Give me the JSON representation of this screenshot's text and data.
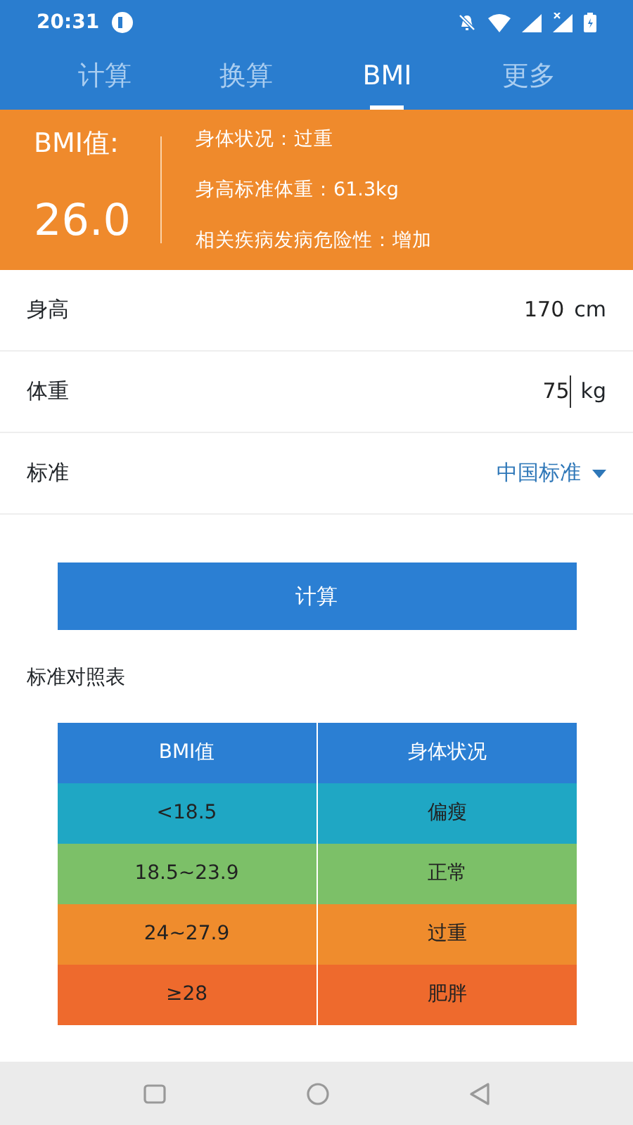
{
  "status_bar": {
    "time": "20:31"
  },
  "tabs": [
    {
      "label": "计算",
      "selected": false
    },
    {
      "label": "换算",
      "selected": false
    },
    {
      "label": "BMI",
      "selected": true
    },
    {
      "label": "更多",
      "selected": false
    }
  ],
  "result": {
    "label": "BMI值:",
    "value": "26.0",
    "details": [
      "身体状况：过重",
      "身高标准体重：61.3kg",
      "相关疾病发病危险性：增加"
    ]
  },
  "fields": [
    {
      "label": "身高",
      "value": "170",
      "unit": "cm",
      "kind": "input",
      "focused": false
    },
    {
      "label": "体重",
      "value": "75",
      "unit": "kg",
      "kind": "input",
      "focused": true
    },
    {
      "label": "标准",
      "value": "中国标准",
      "kind": "dropdown"
    }
  ],
  "button": "计算",
  "table_title": "标准对照表",
  "table": {
    "columns": [
      "BMI值",
      "身体状况"
    ],
    "rows": [
      {
        "cells": [
          "<18.5",
          "偏瘦"
        ],
        "color": "#1fa7c4"
      },
      {
        "cells": [
          "18.5~23.9",
          "正常"
        ],
        "color": "#7cc068"
      },
      {
        "cells": [
          "24~27.9",
          "过重"
        ],
        "color": "#ef8c2d"
      },
      {
        "cells": [
          "≥28",
          "肥胖"
        ],
        "color": "#ee6a2d"
      }
    ]
  }
}
